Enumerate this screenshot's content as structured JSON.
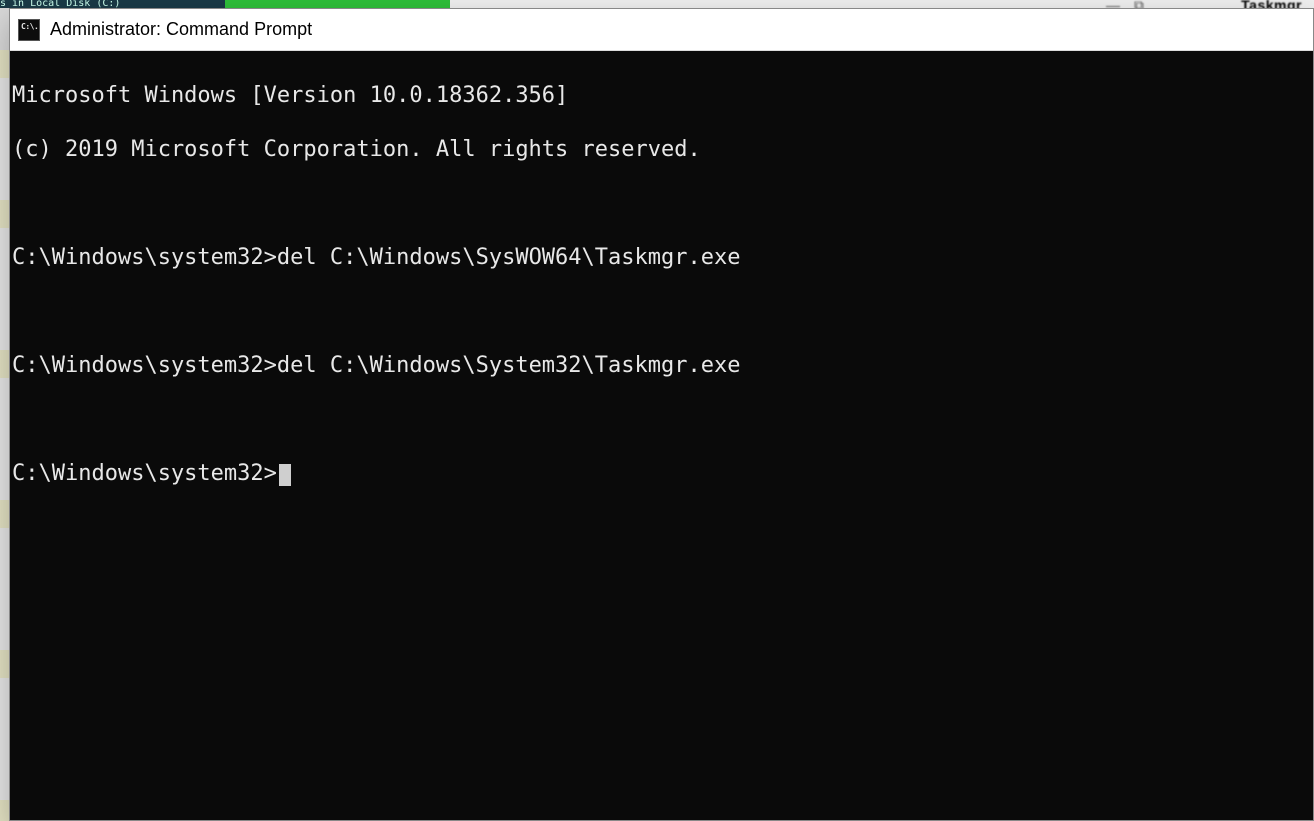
{
  "background": {
    "explorer_fragment": "s in Local Disk (C:)",
    "taskmgr_label": "Taskmgr"
  },
  "window": {
    "title": "Administrator: Command Prompt"
  },
  "terminal": {
    "header_line1": "Microsoft Windows [Version 10.0.18362.356]",
    "header_line2": "(c) 2019 Microsoft Corporation. All rights reserved.",
    "prompt": "C:\\Windows\\system32>",
    "cmd1": "del C:\\Windows\\SysWOW64\\Taskmgr.exe",
    "cmd2": "del C:\\Windows\\System32\\Taskmgr.exe"
  }
}
